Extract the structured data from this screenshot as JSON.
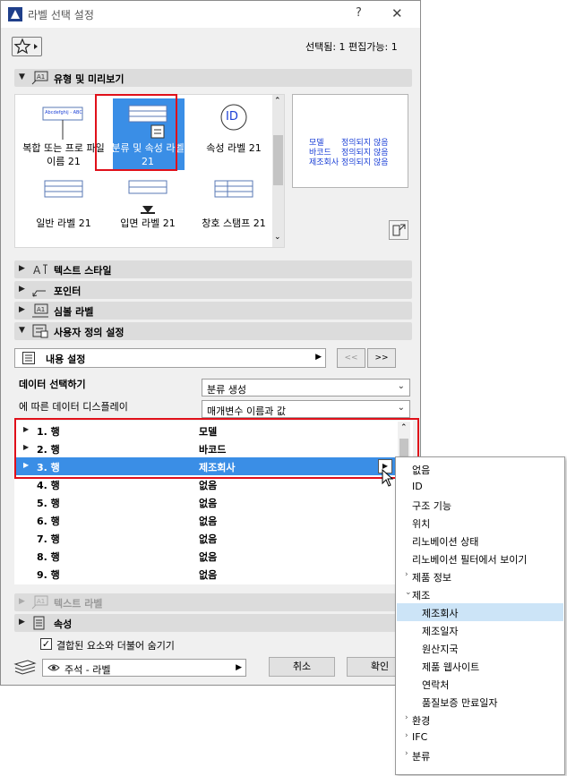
{
  "window": {
    "title": "라벨 선택 설정",
    "help_label": "?",
    "close_label": "✕"
  },
  "header": {
    "selection_status": "선택됨: 1 편집가능: 1"
  },
  "sections": {
    "type_preview": "유형 및 미리보기",
    "text_style": "텍스트 스타일",
    "pointer": "포인터",
    "symbol_label": "심볼 라벨",
    "custom_settings": "사용자 정의 설정",
    "text_label": "텍스트 라벨",
    "properties": "속성"
  },
  "label_types": [
    {
      "label": "복합 또는 프로 파일 이름 21",
      "thumb_text": "Abcdefghij - ABC"
    },
    {
      "label": "분류 및 속성 라벨 21",
      "selected": true
    },
    {
      "label": "속성 라벨 21",
      "thumb_text": "ID"
    },
    {
      "label": "일반 라벨 21"
    },
    {
      "label": "입면 라벨 21"
    },
    {
      "label": "창호 스탬프 21"
    }
  ],
  "preview": {
    "rows": [
      {
        "key": "모델",
        "value": "정의되지 않음"
      },
      {
        "key": "바코드",
        "value": "정의되지 않음"
      },
      {
        "key": "제조회사",
        "value": "정의되지 않음"
      }
    ]
  },
  "content": {
    "setting_label": "내용 설정",
    "prev_label": "<<",
    "next_label": ">>",
    "data_select_label": "데이터 선택하기",
    "data_select_value": "분류 생성",
    "display_label": "에 따른 데이터 디스플레이",
    "display_value": "매개변수 이름과 값"
  },
  "rows": [
    {
      "name": "1. 행",
      "value": "모델",
      "expandable": true
    },
    {
      "name": "2. 행",
      "value": "바코드",
      "expandable": true
    },
    {
      "name": "3. 행",
      "value": "제조회사",
      "expandable": true,
      "selected": true
    },
    {
      "name": "4. 행",
      "value": "없음"
    },
    {
      "name": "5. 행",
      "value": "없음"
    },
    {
      "name": "6. 행",
      "value": "없음"
    },
    {
      "name": "7. 행",
      "value": "없음"
    },
    {
      "name": "8. 행",
      "value": "없음"
    },
    {
      "name": "9. 행",
      "value": "없음"
    }
  ],
  "footer": {
    "hide_checkbox_label": "결합된 요소와 더불어 숨기기",
    "hide_checked": true,
    "layer_value": "주석 - 라벨",
    "cancel_label": "취소",
    "ok_label": "확인"
  },
  "popup_menu": [
    {
      "label": "없음",
      "level": 0
    },
    {
      "label": "ID",
      "level": 0
    },
    {
      "label": "구조 기능",
      "level": 0
    },
    {
      "label": "위치",
      "level": 0
    },
    {
      "label": "리노베이션 상태",
      "level": 0
    },
    {
      "label": "리노베이션 필터에서 보이기",
      "level": 0
    },
    {
      "label": "제품 정보",
      "level": 0,
      "chevron": "›"
    },
    {
      "label": "제조",
      "level": 0,
      "chevron": "⌄"
    },
    {
      "label": "제조회사",
      "level": 1,
      "highlight": true
    },
    {
      "label": "제조일자",
      "level": 1
    },
    {
      "label": "원산지국",
      "level": 1
    },
    {
      "label": "제품 웹사이트",
      "level": 1
    },
    {
      "label": "연락처",
      "level": 1
    },
    {
      "label": "품질보증 만료일자",
      "level": 1
    },
    {
      "label": "환경",
      "level": 0,
      "chevron": "›"
    },
    {
      "label": "IFC",
      "level": 0,
      "chevron": "›"
    },
    {
      "label": "분류",
      "level": 0,
      "chevron": "›"
    }
  ],
  "colors": {
    "accent": "#3a8ee6",
    "highlight_box": "#e0101a",
    "preview_text": "#1a3fd6",
    "menu_highlight": "#cce4f7"
  },
  "icons": [
    "favorite-star-icon",
    "label-section-icon",
    "pointer-icon",
    "symbol-label-icon",
    "custom-settings-icon",
    "properties-icon",
    "layer-icon",
    "eye-icon",
    "scroll-up-icon",
    "scroll-down-icon",
    "preview-action-icon",
    "mouse-cursor-icon"
  ]
}
